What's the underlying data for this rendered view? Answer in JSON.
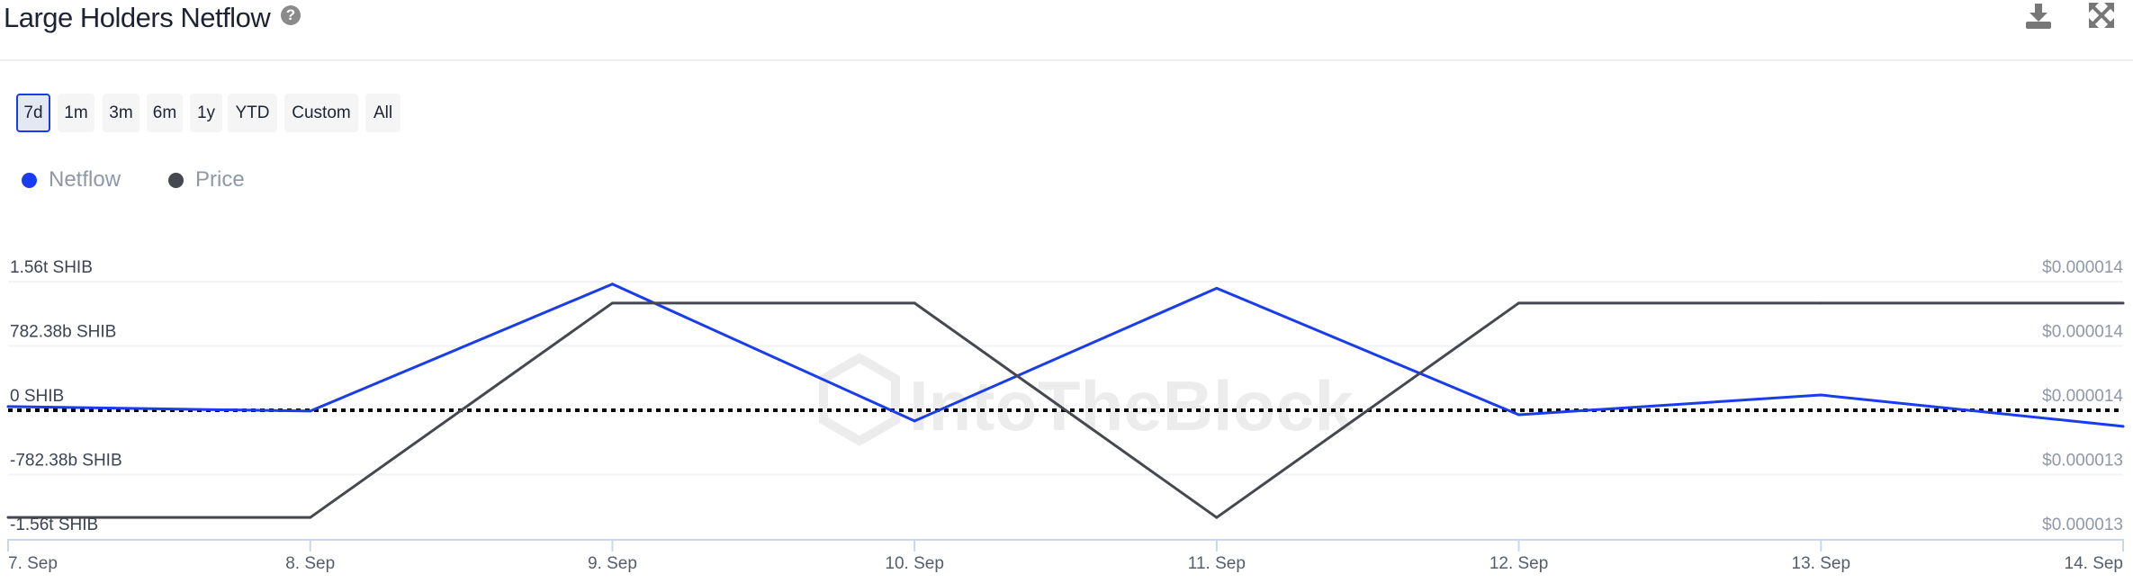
{
  "header": {
    "title": "Large Holders Netflow",
    "help_icon": "question-circle-icon",
    "download_icon": "download-icon",
    "expand_icon": "expand-icon"
  },
  "ranges": [
    {
      "label": "7d",
      "active": true
    },
    {
      "label": "1m"
    },
    {
      "label": "3m"
    },
    {
      "label": "6m"
    },
    {
      "label": "1y"
    },
    {
      "label": "YTD"
    },
    {
      "label": "Custom"
    },
    {
      "label": "All"
    }
  ],
  "legend": [
    {
      "label": "Netflow",
      "color": "#1a3cf0"
    },
    {
      "label": "Price",
      "color": "#45484e"
    }
  ],
  "watermark": "IntoTheBlock",
  "chart_data": {
    "type": "line",
    "categories": [
      "7. Sep",
      "8. Sep",
      "9. Sep",
      "10. Sep",
      "11. Sep",
      "12. Sep",
      "13. Sep",
      "14. Sep"
    ],
    "left_axis": {
      "unit": "b SHIB",
      "range": [
        -1560,
        1560
      ],
      "tick_labels": [
        "1.56t SHIB",
        "782.38b SHIB",
        "0 SHIB",
        "-782.38b SHIB",
        "-1.56t SHIB"
      ]
    },
    "right_axis": {
      "unit": "USD",
      "range": [
        1.33e-05,
        1.39e-05
      ],
      "tick_labels": [
        "$0.000014",
        "$0.000014",
        "$0.000014",
        "$0.000013",
        "$0.000013"
      ]
    },
    "series": [
      {
        "name": "Netflow",
        "axis": "left",
        "color": "#1a3cf0",
        "values": [
          45,
          -10,
          1530,
          -130,
          1480,
          -55,
          185,
          -195
        ]
      },
      {
        "name": "Price",
        "axis": "right",
        "color": "#45484e",
        "values": [
          1.335e-05,
          1.335e-05,
          1.385e-05,
          1.385e-05,
          1.335e-05,
          1.385e-05,
          1.385e-05,
          1.385e-05
        ]
      }
    ],
    "zero_line": "dotted",
    "grid": true
  }
}
